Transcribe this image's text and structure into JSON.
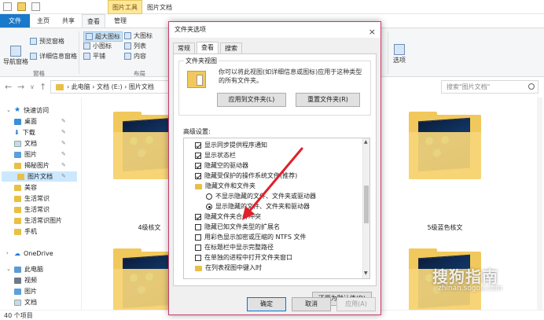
{
  "explorer": {
    "context_tab": "图片工具",
    "window_title": "图片文档",
    "tabs": [
      "文件",
      "主页",
      "共享",
      "查看",
      "管理"
    ],
    "ribbon": {
      "nav_pane": "导航窗格",
      "preview_pane": "预览窗格",
      "details_pane": "详细信息窗格",
      "pane_group": "窗格",
      "extra_large_icons": "超大图标",
      "large_icons": "大图标",
      "small_icons": "小图标",
      "list": "列表",
      "tiles": "平铺",
      "content": "内容",
      "layout_group": "布局",
      "options": "选项"
    },
    "address": {
      "crumb_1": "此电脑",
      "crumb_2": "文档 (E:)",
      "crumb_3": "图片文档",
      "search_placeholder": "搜索\"图片文档\""
    },
    "nav": {
      "quick_access": "快速访问",
      "desktop": "桌面",
      "downloads": "下载",
      "documents": "文档",
      "pictures": "图片",
      "item_5": "揭秘图片",
      "item_6": "图片文档",
      "item_7": "美容",
      "item_8": "生活常识",
      "item_9": "生活常识",
      "item_10": "生活常识图片",
      "item_11": "手机",
      "onedrive": "OneDrive",
      "this_pc": "此电脑",
      "videos": "视频",
      "pictures2": "图片",
      "documents2": "文档"
    },
    "files": {
      "left_label": "4级核文",
      "right_label": "5级蓝色核文"
    },
    "status": "40 个项目",
    "watermark": "搜狗指南",
    "watermark_sub": "zhinan.sogou.com"
  },
  "dialog": {
    "title": "文件夹选项",
    "close": "×",
    "tabs": [
      "常规",
      "查看",
      "搜索"
    ],
    "folder_views_legend": "文件夹视图",
    "folder_views_desc": "你可以将此视图(如详细信息或图标)应用于这种类型的所有文件夹。",
    "apply_button": "应用到文件夹(L)",
    "reset_button": "重置文件夹(R)",
    "advanced_label": "高级设置:",
    "advanced": [
      "显示同步提供程序通知",
      "显示状态栏",
      "隐藏空的驱动器",
      "隐藏受保护的操作系统文件(推荐)",
      "隐藏文件和文件夹",
      "不显示隐藏的文件、文件夹或驱动器",
      "显示隐藏的文件、文件夹和驱动器",
      "隐藏文件夹合并冲突",
      "隐藏已知文件类型的扩展名",
      "用彩色显示加密或压缩的 NTFS 文件",
      "在标题栏中显示完整路径",
      "在单独的进程中打开文件夹窗口",
      "在列表视图中键入时"
    ],
    "restore_button": "还原为默认值(D)",
    "ok_button": "确定",
    "cancel_button": "取消",
    "apply_disabled": "应用(A)"
  },
  "colors": {
    "file_tab": "#1979ca",
    "dialog_border": "#c73b6b",
    "annotation_arrow": "#e0202a"
  }
}
